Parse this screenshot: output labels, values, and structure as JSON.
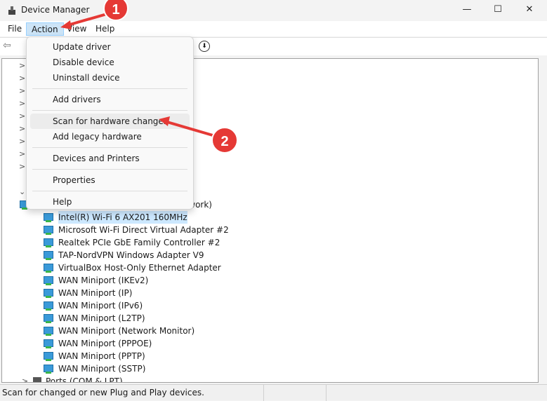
{
  "window": {
    "title": "Device Manager",
    "minimize": "—",
    "maximize": "☐",
    "close": "✕"
  },
  "menubar": [
    "File",
    "Action",
    "View",
    "Help"
  ],
  "action_menu": {
    "groups": [
      [
        "Update driver",
        "Disable device",
        "Uninstall device"
      ],
      [
        "Add drivers"
      ],
      [
        "Scan for hardware changes",
        "Add legacy hardware"
      ],
      [
        "Devices and Printers"
      ],
      [
        "Properties"
      ],
      [
        "Help"
      ]
    ],
    "highlighted": "Scan for hardware changes"
  },
  "tree": {
    "partial_row": "Bluetooth Device (Personal Area Network)",
    "devices": [
      "Intel(R) Wi-Fi 6 AX201 160MHz",
      "Microsoft Wi-Fi Direct Virtual Adapter #2",
      "Realtek PCIe GbE Family Controller #2",
      "TAP-NordVPN Windows Adapter V9",
      "VirtualBox Host-Only Ethernet Adapter",
      "WAN Miniport (IKEv2)",
      "WAN Miniport (IP)",
      "WAN Miniport (IPv6)",
      "WAN Miniport (L2TP)",
      "WAN Miniport (Network Monitor)",
      "WAN Miniport (PPPOE)",
      "WAN Miniport (PPTP)",
      "WAN Miniport (SSTP)"
    ],
    "selected": "Intel(R) Wi-Fi 6 AX201 160MHz",
    "next_category": "Ports (COM & LPT)"
  },
  "status": "Scan for changed or new Plug and Play devices.",
  "annotations": {
    "step1": "1",
    "step2": "2",
    "color": "#e53935"
  }
}
